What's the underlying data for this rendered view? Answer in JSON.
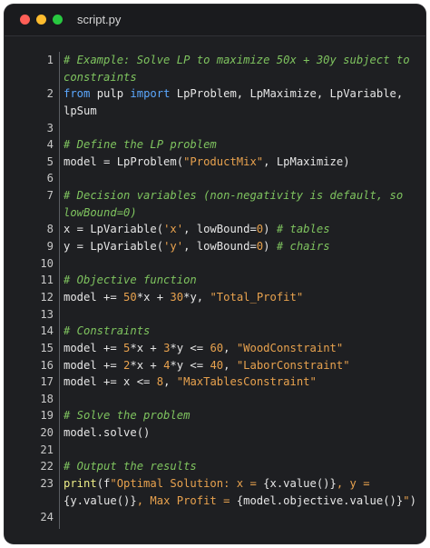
{
  "window": {
    "title": "script.py",
    "controls": {
      "close_color": "#ff5f57",
      "minimize_color": "#febc2e",
      "maximize_color": "#28c840"
    }
  },
  "code": {
    "lines": [
      {
        "n": "1",
        "segments": [
          {
            "t": "# Example: Solve LP to maximize 50x + 30y subject to",
            "c": "cmt"
          }
        ]
      },
      {
        "n": "",
        "segments": [
          {
            "t": "constraints",
            "c": "cmt"
          }
        ]
      },
      {
        "n": "2",
        "segments": [
          {
            "t": "from",
            "c": "kw"
          },
          {
            "t": " pulp ",
            "c": "plain"
          },
          {
            "t": "import",
            "c": "kw"
          },
          {
            "t": " LpProblem, LpMaximize, LpVariable,",
            "c": "plain"
          }
        ]
      },
      {
        "n": "",
        "segments": [
          {
            "t": "lpSum",
            "c": "plain"
          }
        ]
      },
      {
        "n": "3",
        "segments": []
      },
      {
        "n": "4",
        "segments": [
          {
            "t": "# Define the LP problem",
            "c": "cmt"
          }
        ]
      },
      {
        "n": "5",
        "segments": [
          {
            "t": "model = LpProblem(",
            "c": "plain"
          },
          {
            "t": "\"ProductMix\"",
            "c": "str"
          },
          {
            "t": ", LpMaximize)",
            "c": "plain"
          }
        ]
      },
      {
        "n": "6",
        "segments": []
      },
      {
        "n": "7",
        "segments": [
          {
            "t": "# Decision variables (non-negativity is default, so",
            "c": "cmt"
          }
        ]
      },
      {
        "n": "",
        "segments": [
          {
            "t": "lowBound=0)",
            "c": "cmt"
          }
        ]
      },
      {
        "n": "8",
        "segments": [
          {
            "t": "x = LpVariable(",
            "c": "plain"
          },
          {
            "t": "'x'",
            "c": "str"
          },
          {
            "t": ", lowBound=",
            "c": "plain"
          },
          {
            "t": "0",
            "c": "num"
          },
          {
            "t": ") ",
            "c": "plain"
          },
          {
            "t": "# tables",
            "c": "cmt"
          }
        ]
      },
      {
        "n": "9",
        "segments": [
          {
            "t": "y = LpVariable(",
            "c": "plain"
          },
          {
            "t": "'y'",
            "c": "str"
          },
          {
            "t": ", lowBound=",
            "c": "plain"
          },
          {
            "t": "0",
            "c": "num"
          },
          {
            "t": ") ",
            "c": "plain"
          },
          {
            "t": "# chairs",
            "c": "cmt"
          }
        ]
      },
      {
        "n": "10",
        "segments": []
      },
      {
        "n": "11",
        "segments": [
          {
            "t": "# Objective function",
            "c": "cmt"
          }
        ]
      },
      {
        "n": "12",
        "segments": [
          {
            "t": "model += ",
            "c": "plain"
          },
          {
            "t": "50",
            "c": "num"
          },
          {
            "t": "*x + ",
            "c": "plain"
          },
          {
            "t": "30",
            "c": "num"
          },
          {
            "t": "*y, ",
            "c": "plain"
          },
          {
            "t": "\"Total_Profit\"",
            "c": "str"
          }
        ]
      },
      {
        "n": "13",
        "segments": []
      },
      {
        "n": "14",
        "segments": [
          {
            "t": "# Constraints",
            "c": "cmt"
          }
        ]
      },
      {
        "n": "15",
        "segments": [
          {
            "t": "model += ",
            "c": "plain"
          },
          {
            "t": "5",
            "c": "num"
          },
          {
            "t": "*x + ",
            "c": "plain"
          },
          {
            "t": "3",
            "c": "num"
          },
          {
            "t": "*y <= ",
            "c": "plain"
          },
          {
            "t": "60",
            "c": "num"
          },
          {
            "t": ", ",
            "c": "plain"
          },
          {
            "t": "\"WoodConstraint\"",
            "c": "str"
          }
        ]
      },
      {
        "n": "16",
        "segments": [
          {
            "t": "model += ",
            "c": "plain"
          },
          {
            "t": "2",
            "c": "num"
          },
          {
            "t": "*x + ",
            "c": "plain"
          },
          {
            "t": "4",
            "c": "num"
          },
          {
            "t": "*y <= ",
            "c": "plain"
          },
          {
            "t": "40",
            "c": "num"
          },
          {
            "t": ", ",
            "c": "plain"
          },
          {
            "t": "\"LaborConstraint\"",
            "c": "str"
          }
        ]
      },
      {
        "n": "17",
        "segments": [
          {
            "t": "model += x <= ",
            "c": "plain"
          },
          {
            "t": "8",
            "c": "num"
          },
          {
            "t": ", ",
            "c": "plain"
          },
          {
            "t": "\"MaxTablesConstraint\"",
            "c": "str"
          }
        ]
      },
      {
        "n": "18",
        "segments": []
      },
      {
        "n": "19",
        "segments": [
          {
            "t": "# Solve the problem",
            "c": "cmt"
          }
        ]
      },
      {
        "n": "20",
        "segments": [
          {
            "t": "model.solve()",
            "c": "plain"
          }
        ]
      },
      {
        "n": "21",
        "segments": []
      },
      {
        "n": "22",
        "segments": [
          {
            "t": "# Output the results",
            "c": "cmt"
          }
        ]
      },
      {
        "n": "23",
        "segments": [
          {
            "t": "print",
            "c": "fn"
          },
          {
            "t": "(f",
            "c": "plain"
          },
          {
            "t": "\"Optimal Solution: x = ",
            "c": "str"
          },
          {
            "t": "{x.value()}",
            "c": "plain"
          },
          {
            "t": ", y =",
            "c": "str"
          }
        ]
      },
      {
        "n": "",
        "segments": [
          {
            "t": "{y.value()}",
            "c": "plain"
          },
          {
            "t": ", Max Profit = ",
            "c": "str"
          },
          {
            "t": "{model.objective.value()}",
            "c": "plain"
          },
          {
            "t": "\"",
            "c": "str"
          },
          {
            "t": ")",
            "c": "plain"
          }
        ]
      },
      {
        "n": "24",
        "segments": []
      }
    ]
  }
}
